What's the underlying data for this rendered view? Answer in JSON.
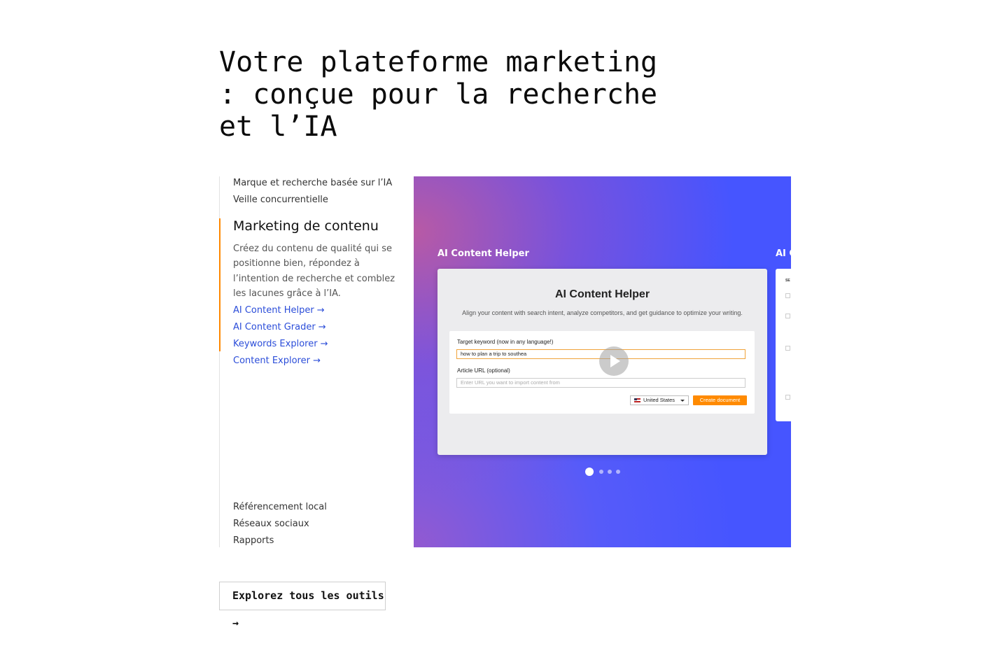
{
  "heading": {
    "title": "Votre plateforme marketing : conçue pour la recherche et l’IA"
  },
  "nav": {
    "items_top": [
      "Marque et recherche basée sur l’IA",
      "Veille concurrentielle"
    ],
    "active": {
      "title": "Marketing de contenu",
      "description": "Créez du contenu de qualité qui se positionne bien, répondez à l’intention de recherche et comblez les lacunes grâce à l’IA.",
      "links": [
        "AI Content Helper →",
        "AI Content Grader →",
        "Keywords Explorer →",
        "Content Explorer →"
      ]
    },
    "items_bottom": [
      "Référencement local",
      "Réseaux sociaux",
      "Rapports"
    ]
  },
  "carousel": {
    "colors": {
      "accent": "#4655ff",
      "gradient": "#b45ca0"
    },
    "slides": [
      {
        "label": "AI Content Helper",
        "screenshot": {
          "title": "AI Content Helper",
          "subtitle": "Align your content with search intent, analyze competitors, and get guidance to optimize your writing.",
          "keyword_label": "Target keyword (now in any language!)",
          "keyword_value": "how to plan a trip to southea",
          "url_label": "Article URL (optional)",
          "url_placeholder": "Enter URL you want to import content from",
          "country": "United States",
          "create_button": "Create document",
          "play_icon": "play-icon"
        }
      },
      {
        "label": "AI C",
        "screenshot": {
          "header": "SE"
        }
      }
    ],
    "active_index": 0,
    "dot_count": 4
  },
  "cta": {
    "label": "Explorez tous les outils →"
  },
  "colors": {
    "active_border": "#ff8800",
    "link": "#2b4dd9",
    "create_button": "#ff8a00"
  }
}
